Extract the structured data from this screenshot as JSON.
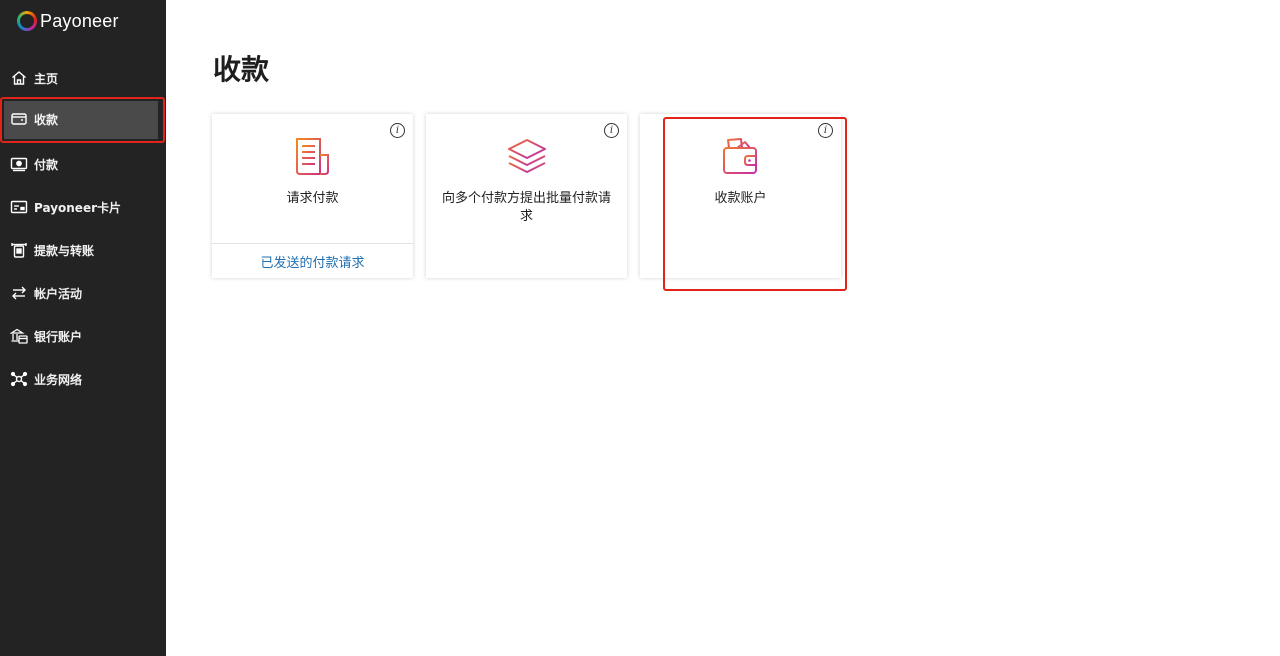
{
  "app": {
    "brand": "Payoneer"
  },
  "sidebar": {
    "items": [
      {
        "label": "主页",
        "icon": "home-icon"
      },
      {
        "label": "收款",
        "icon": "wallet-icon",
        "active": true
      },
      {
        "label": "付款",
        "icon": "payment-icon"
      },
      {
        "label": "Payoneer卡片",
        "icon": "card-icon"
      },
      {
        "label": "提款与转账",
        "icon": "withdraw-icon"
      },
      {
        "label": "帐户活动",
        "icon": "transfer-arrows-icon"
      },
      {
        "label": "银行账户",
        "icon": "bank-icon"
      },
      {
        "label": "业务网络",
        "icon": "network-icon"
      }
    ]
  },
  "main": {
    "title": "收款",
    "cards": [
      {
        "label": "请求付款",
        "icon": "document-icon",
        "footer": "已发送的付款请求"
      },
      {
        "label": "向多个付款方提出批量付款请求",
        "icon": "layers-icon"
      },
      {
        "label": "收款账户",
        "icon": "wallet-cards-icon"
      }
    ]
  },
  "colors": {
    "sidebar_bg": "#232323",
    "highlight": "#e02418",
    "link": "#1f6fb3",
    "accent_gradient": [
      "#f08a24",
      "#c62ca8"
    ]
  }
}
